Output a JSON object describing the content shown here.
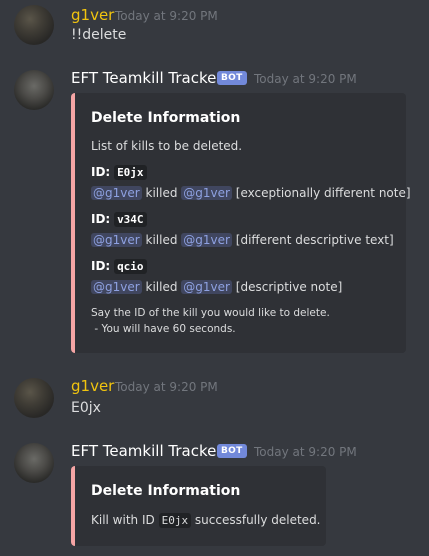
{
  "messages": [
    {
      "author": "g1ver",
      "timestamp": "Today at 9:20 PM",
      "text": "!!delete"
    },
    {
      "author": "EFT Teamkill Tracker",
      "badge": "BOT",
      "timestamp": "Today at 9:20 PM",
      "embed": {
        "title": "Delete Information",
        "description": "List of kills to be deleted.",
        "entries": [
          {
            "id_label": "ID:",
            "id": "E0jx",
            "killer": "@g1ver",
            "verb": "killed",
            "victim": "@g1ver",
            "note": "[exceptionally different note]"
          },
          {
            "id_label": "ID:",
            "id": "v34C",
            "killer": "@g1ver",
            "verb": "killed",
            "victim": "@g1ver",
            "note": "[different descriptive text]"
          },
          {
            "id_label": "ID:",
            "id": "qcio",
            "killer": "@g1ver",
            "verb": "killed",
            "victim": "@g1ver",
            "note": "[descriptive note]"
          }
        ],
        "footer_line1": "Say the ID of the kill you would like to delete.",
        "footer_line2": " - You will have 60 seconds."
      }
    },
    {
      "author": "g1ver",
      "timestamp": "Today at 9:20 PM",
      "text": "E0jx"
    },
    {
      "author": "EFT Teamkill Tracker",
      "badge": "BOT",
      "timestamp": "Today at 9:20 PM",
      "embed": {
        "title": "Delete Information",
        "pre": "Kill with ID",
        "code": "E0jx",
        "post": "successfully deleted."
      }
    }
  ],
  "colors": {
    "background": "#36393f",
    "embed_bg": "#2f3136",
    "embed_accent": "#f5a5a5",
    "username_user": "#f1c40f",
    "bot_badge": "#7289da",
    "mention": "#8ea1e1"
  }
}
